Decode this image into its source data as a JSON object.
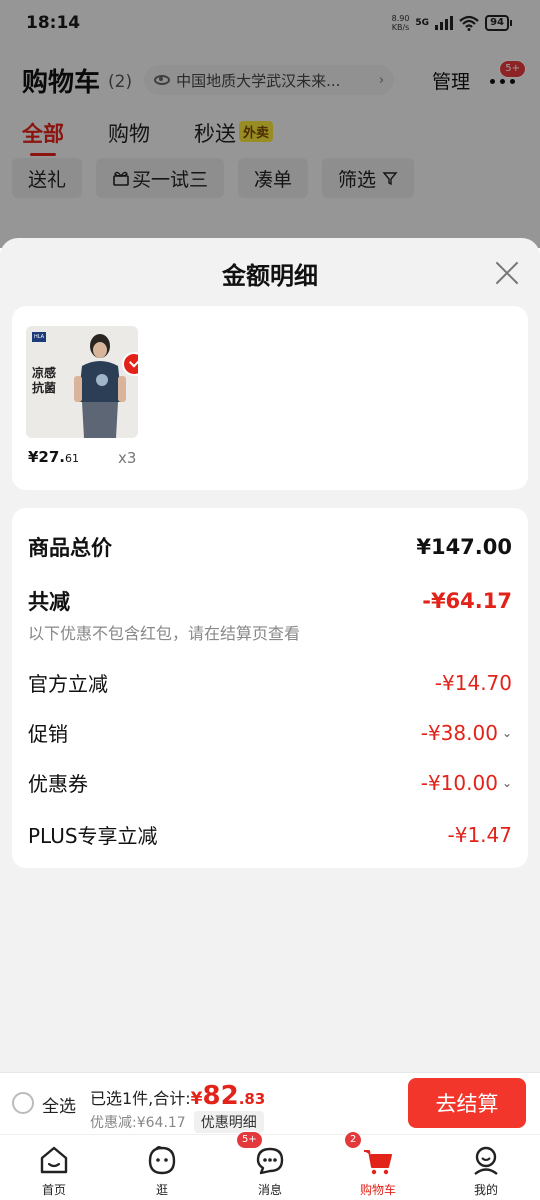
{
  "status_bar": {
    "time": "18:14",
    "net_speed_value": "8.90",
    "net_speed_unit": "KB/s",
    "network": "5G",
    "battery": "94"
  },
  "cart": {
    "title": "购物车",
    "count": "(2)",
    "address": "中国地质大学武汉未来...",
    "manage_label": "管理",
    "more_badge": "5+",
    "tabs": [
      {
        "label": "全部",
        "active": true
      },
      {
        "label": "购物",
        "active": false
      },
      {
        "label": "秒送",
        "active": false,
        "badge": "外卖"
      }
    ],
    "filters": [
      {
        "label": "送礼",
        "icon": ""
      },
      {
        "label": "买一试三",
        "icon": "gift-icon"
      },
      {
        "label": "凑单",
        "icon": ""
      },
      {
        "label": "筛选",
        "icon": "filter-icon"
      }
    ]
  },
  "sheet": {
    "title": "金额明细",
    "product": {
      "thumb_text_line1": "凉感",
      "thumb_text_line2": "抗菌",
      "price_main": "¥27.",
      "price_decimal": "61",
      "quantity": "x3"
    },
    "breakdown": {
      "total_label": "商品总价",
      "total_value": "¥147.00",
      "reduce_label": "共减",
      "reduce_value": "-¥64.17",
      "note": "以下优惠不包含红包，请在结算页查看",
      "items": [
        {
          "label": "官方立减",
          "value": "-¥14.70",
          "expandable": false
        },
        {
          "label": "促销",
          "value": "-¥38.00",
          "expandable": true
        },
        {
          "label": "优惠券",
          "value": "-¥10.00",
          "expandable": true
        },
        {
          "label": "PLUS专享立减",
          "value": "-¥1.47",
          "expandable": false
        }
      ]
    }
  },
  "checkout": {
    "select_all_label": "全选",
    "summary_prefix": "已选1件,合计:",
    "total_yen": "¥",
    "total_int": "82",
    "total_dec": ".83",
    "discount_text": "优惠减:¥64.17",
    "detail_label": "优惠明细",
    "button_label": "去结算"
  },
  "bottom_nav": [
    {
      "label": "首页",
      "icon": "home-icon",
      "active": false,
      "badge": ""
    },
    {
      "label": "逛",
      "icon": "face-icon",
      "active": false,
      "badge": ""
    },
    {
      "label": "消息",
      "icon": "message-icon",
      "active": false,
      "badge": "5+"
    },
    {
      "label": "购物车",
      "icon": "cart-icon",
      "active": true,
      "badge": "2"
    },
    {
      "label": "我的",
      "icon": "profile-icon",
      "active": false,
      "badge": ""
    }
  ],
  "colors": {
    "accent": "#e2231a",
    "checkout_button": "#f2362b",
    "sheet_background": "#f2f2f2"
  }
}
